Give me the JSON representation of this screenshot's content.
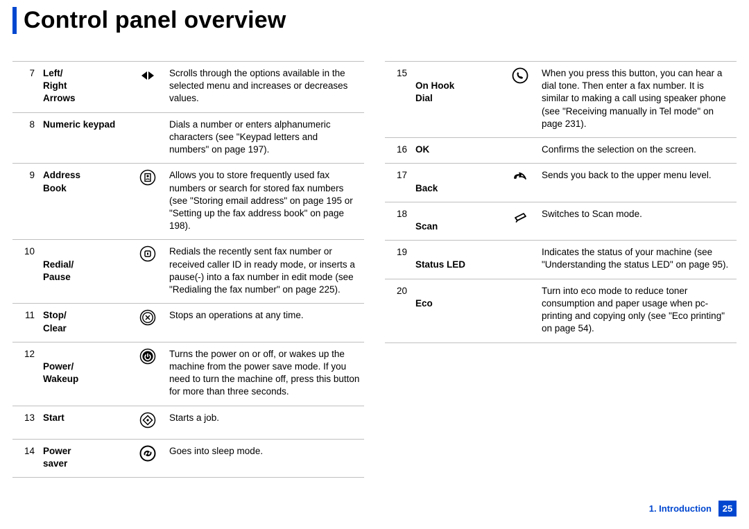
{
  "title": "Control panel overview",
  "footer": {
    "chapter": "1. Introduction",
    "page": "25"
  },
  "left": [
    {
      "num": "7",
      "name": "Left/\nRight\nArrows",
      "icon": "left-right-arrows-icon",
      "desc": "Scrolls through the options available in the selected menu and increases or decreases values."
    },
    {
      "num": "8",
      "name": "Numeric keypad",
      "icon": "",
      "desc": "Dials a number or enters alphanumeric characters (see \"Keypad letters and numbers\" on page 197)."
    },
    {
      "num": "9",
      "name": "Address\nBook",
      "icon": "address-book-icon",
      "desc": "Allows you to store frequently used fax numbers or search for stored fax numbers (see \"Storing email address\" on page 195 or \"Setting up the fax address book\" on page 198)."
    },
    {
      "num": "10",
      "name": "\nRedial/\nPause",
      "icon": "redial-pause-icon",
      "desc": "Redials the recently sent fax number or received caller ID in ready mode, or inserts a pause(-) into a fax number in edit mode (see \"Redialing the fax number\" on page 225)."
    },
    {
      "num": "11",
      "name": "Stop/\nClear",
      "icon": "stop-clear-icon",
      "desc": "Stops an operations at any time."
    },
    {
      "num": "12",
      "name": "\nPower/\nWakeup",
      "icon": "power-wakeup-icon",
      "desc": "Turns the power on or off, or wakes up the machine from the power save mode. If you need to turn the machine off, press this button for more than three seconds."
    },
    {
      "num": "13",
      "name": "Start",
      "icon": "start-icon",
      "desc": "Starts a job."
    },
    {
      "num": "14",
      "name": "Power\nsaver",
      "icon": "power-saver-icon",
      "desc": "Goes into sleep mode."
    }
  ],
  "right": [
    {
      "num": "15",
      "name": "\nOn Hook\nDial",
      "icon": "on-hook-dial-icon",
      "desc": "When you press this button, you can hear a dial tone. Then enter a fax number. It is similar to making a call using speaker phone (see \"Receiving manually in Tel mode\" on page 231)."
    },
    {
      "num": "16",
      "name": "OK",
      "icon": "",
      "desc": "Confirms the selection on the screen."
    },
    {
      "num": "17",
      "name": "\nBack",
      "icon": "back-icon",
      "desc": "Sends you back to the upper menu level."
    },
    {
      "num": "18",
      "name": "\nScan",
      "icon": "scan-icon",
      "desc": "Switches to Scan mode."
    },
    {
      "num": "19",
      "name": "\nStatus LED",
      "icon": "",
      "desc": "Indicates the status of your machine (see \"Understanding the status LED\" on page 95)."
    },
    {
      "num": "20",
      "name": "\nEco",
      "icon": "",
      "desc": "Turn into eco mode to reduce toner consumption and paper usage when pc-printing and copying only (see \"Eco printing\" on page 54)."
    }
  ]
}
